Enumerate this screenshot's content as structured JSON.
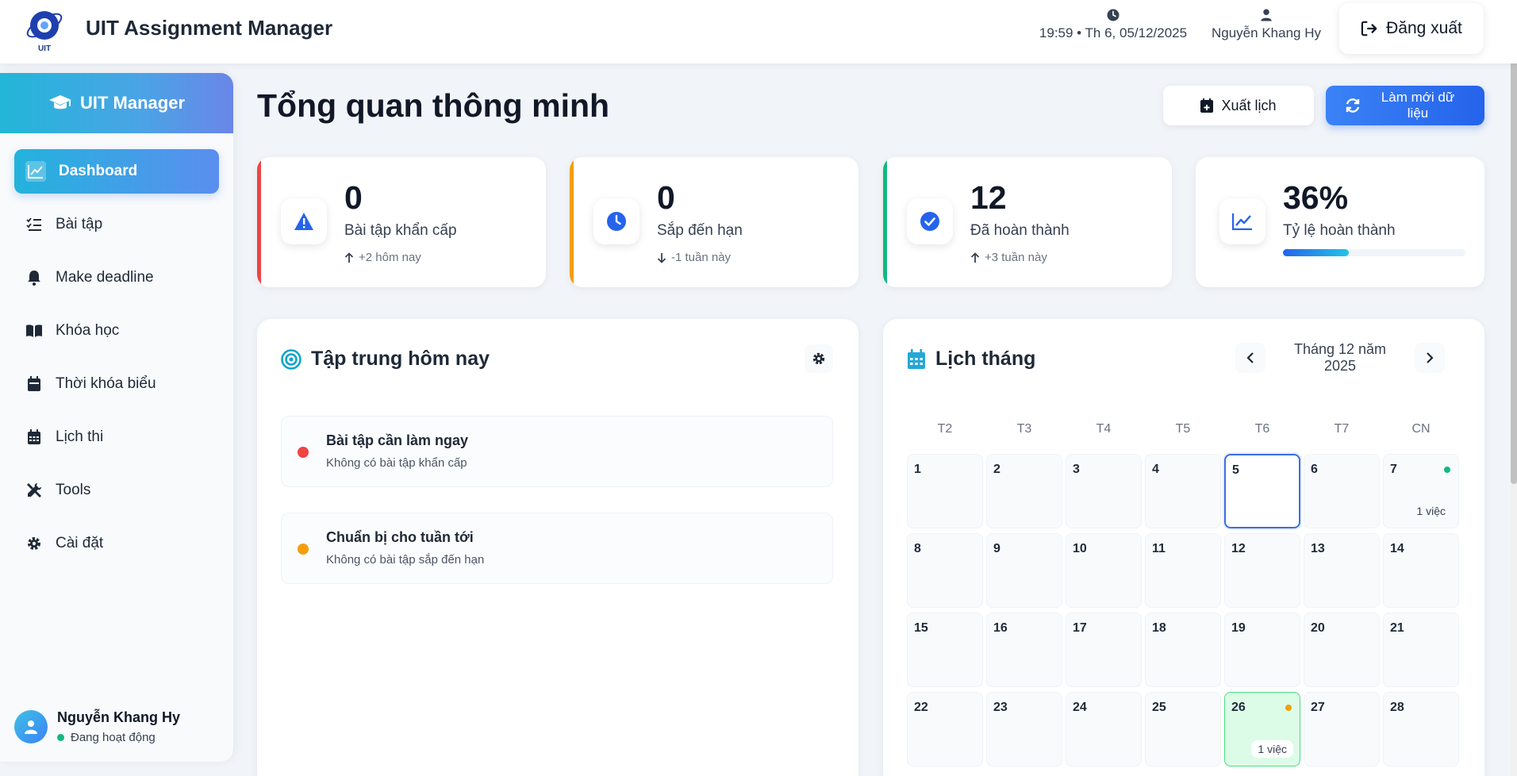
{
  "app": {
    "title": "UIT Assignment Manager",
    "logo_text": "UIT",
    "datetime": "19:59 • Th 6, 05/12/2025",
    "user_name": "Nguyễn Khang Hy",
    "logout_label": "Đăng xuất"
  },
  "sidebar": {
    "brand": "UIT Manager",
    "items": [
      {
        "label": "Dashboard",
        "icon": "chart-line-icon",
        "active": true
      },
      {
        "label": "Bài tập",
        "icon": "tasks-list-icon",
        "active": false
      },
      {
        "label": "Make deadline",
        "icon": "bell-icon",
        "active": false
      },
      {
        "label": "Khóa học",
        "icon": "book-icon",
        "active": false
      },
      {
        "label": "Thời khóa biểu",
        "icon": "calendar-icon",
        "active": false
      },
      {
        "label": "Lịch thi",
        "icon": "calendar-grid-icon",
        "active": false
      },
      {
        "label": "Tools",
        "icon": "tools-icon",
        "active": false
      },
      {
        "label": "Cài đặt",
        "icon": "gear-icon",
        "active": false
      }
    ],
    "user": {
      "name": "Nguyễn Khang Hy",
      "status": "Đang hoạt động"
    }
  },
  "page": {
    "title": "Tổng quan thông minh",
    "export_label": "Xuất lịch",
    "refresh_label": "Làm mới dữ liệu"
  },
  "stats": [
    {
      "value": "0",
      "label": "Bài tập khẩn cấp",
      "trend": "+2 hôm nay",
      "trend_dir": "up",
      "accent": "#ef4444",
      "icon": "warning-icon",
      "icon_color": "#2563eb"
    },
    {
      "value": "0",
      "label": "Sắp đến hạn",
      "trend": "-1 tuần này",
      "trend_dir": "down",
      "accent": "#f59e0b",
      "icon": "clock-icon",
      "icon_color": "#2563eb"
    },
    {
      "value": "12",
      "label": "Đã hoàn thành",
      "trend": "+3 tuần này",
      "trend_dir": "up",
      "accent": "#10b981",
      "icon": "check-circle-icon",
      "icon_color": "#2563eb"
    },
    {
      "value": "36%",
      "label": "Tỷ lệ hoàn thành",
      "progress": 0.36,
      "accent": "",
      "icon": "chart-line-icon",
      "icon_color": "#2563eb"
    }
  ],
  "focus": {
    "title": "Tập trung hôm nay",
    "items": [
      {
        "title": "Bài tập cần làm ngay",
        "subtitle": "Không có bài tập khẩn cấp",
        "dot_color": "#ef4444"
      },
      {
        "title": "Chuẩn bị cho tuần tới",
        "subtitle": "Không có bài tập sắp đến hạn",
        "dot_color": "#f59e0b"
      }
    ]
  },
  "calendar": {
    "title": "Lịch tháng",
    "month_label": "Tháng 12 năm 2025",
    "weekdays": [
      "T2",
      "T3",
      "T4",
      "T5",
      "T6",
      "T7",
      "CN"
    ],
    "today": 5,
    "days": [
      {
        "n": "1"
      },
      {
        "n": "2"
      },
      {
        "n": "3"
      },
      {
        "n": "4"
      },
      {
        "n": "5",
        "today": true
      },
      {
        "n": "6"
      },
      {
        "n": "7",
        "dot": "#10b981",
        "badge": "1 việc"
      },
      {
        "n": "8"
      },
      {
        "n": "9"
      },
      {
        "n": "10"
      },
      {
        "n": "11"
      },
      {
        "n": "12"
      },
      {
        "n": "13"
      },
      {
        "n": "14"
      },
      {
        "n": "15"
      },
      {
        "n": "16"
      },
      {
        "n": "17"
      },
      {
        "n": "18"
      },
      {
        "n": "19"
      },
      {
        "n": "20"
      },
      {
        "n": "21"
      },
      {
        "n": "22"
      },
      {
        "n": "23"
      },
      {
        "n": "24"
      },
      {
        "n": "25"
      },
      {
        "n": "26",
        "dot": "#f59e0b",
        "badge": "1 việc",
        "highlight": true
      },
      {
        "n": "27"
      },
      {
        "n": "28"
      }
    ]
  }
}
